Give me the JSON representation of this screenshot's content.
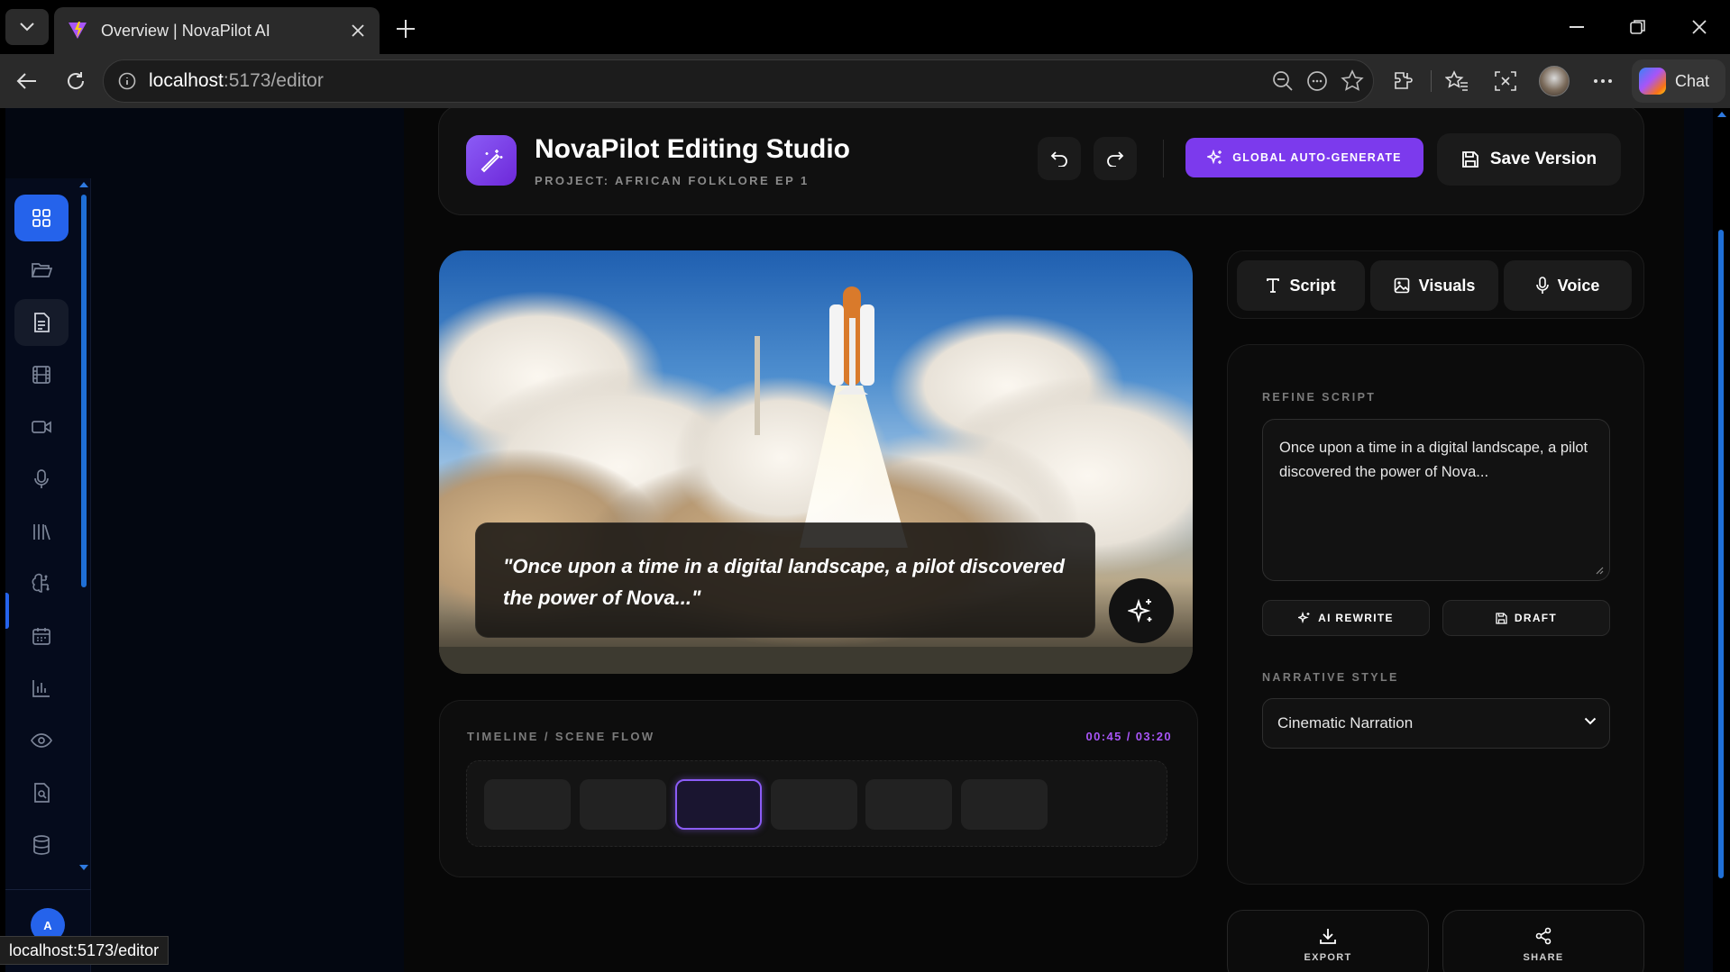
{
  "browser": {
    "tab_title": "Overview | NovaPilot AI",
    "url_host": "localhost",
    "url_path": ":5173/editor",
    "chat_label": "Chat",
    "status_url": "localhost:5173/editor"
  },
  "sidebar": {
    "items": [
      {
        "name": "dashboard",
        "icon": "grid-icon",
        "active": true
      },
      {
        "name": "projects",
        "icon": "folder-icon"
      },
      {
        "name": "scripts",
        "icon": "document-icon"
      },
      {
        "name": "scenes",
        "icon": "film-icon"
      },
      {
        "name": "video",
        "icon": "video-icon"
      },
      {
        "name": "voice",
        "icon": "mic-icon"
      },
      {
        "name": "library",
        "icon": "library-icon"
      },
      {
        "name": "ai-studio",
        "icon": "brain-icon"
      },
      {
        "name": "calendar",
        "icon": "calendar-icon"
      },
      {
        "name": "analytics",
        "icon": "bar-chart-icon"
      },
      {
        "name": "preview",
        "icon": "eye-icon"
      },
      {
        "name": "file-search",
        "icon": "file-search-icon"
      },
      {
        "name": "database",
        "icon": "database-icon"
      }
    ],
    "avatar_initial": "A",
    "accent": "#2563eb"
  },
  "header": {
    "title": "NovaPilot Editing Studio",
    "subtitle": "PROJECT: AFRICAN FOLKLORE EP 1",
    "auto_generate_label": "GLOBAL AUTO-GENERATE",
    "save_label": "Save Version",
    "accent": "#7c3aed"
  },
  "preview": {
    "caption": "\"Once upon a time in a digital landscape, a pilot discovered the power of Nova...\""
  },
  "timeline": {
    "label": "TIMELINE / SCENE FLOW",
    "time": "00:45 / 03:20",
    "clips": 6,
    "selected_clip": 3
  },
  "tabs": [
    {
      "label": "Script",
      "icon": "type-icon"
    },
    {
      "label": "Visuals",
      "icon": "image-icon"
    },
    {
      "label": "Voice",
      "icon": "mic-icon"
    }
  ],
  "refine": {
    "label": "REFINE SCRIPT",
    "text": "Once upon a time in a digital landscape, a pilot discovered the power of Nova...",
    "rewrite_label": "AI REWRITE",
    "draft_label": "DRAFT",
    "style_label": "NARRATIVE STYLE",
    "style_value": "Cinematic Narration"
  },
  "actions": {
    "export_label": "EXPORT",
    "share_label": "SHARE"
  }
}
